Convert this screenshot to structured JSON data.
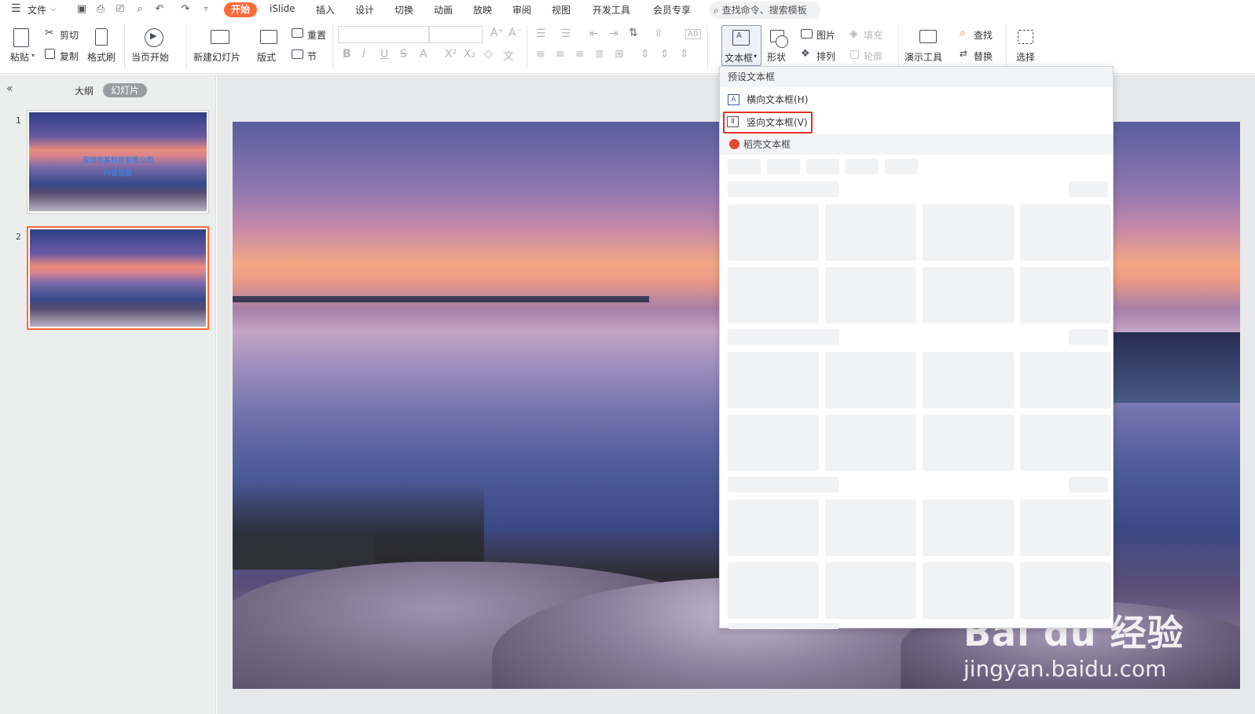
{
  "menubar": {
    "file_label": "文件",
    "tabs": [
      "开始",
      "iSlide",
      "插入",
      "设计",
      "切换",
      "动画",
      "放映",
      "审阅",
      "视图",
      "开发工具",
      "会员专享"
    ],
    "search_placeholder": "查找命令、搜索模板"
  },
  "ribbon": {
    "paste": "粘贴",
    "cut": "剪切",
    "copy": "复制",
    "format_painter": "格式刷",
    "from_current": "当页开始",
    "new_slide": "新建幻灯片",
    "layout": "版式",
    "reset": "重置",
    "section": "节",
    "textbox": "文本框",
    "shapes": "形状",
    "picture": "图片",
    "arrange": "排列",
    "fill": "填充",
    "outline": "轮廓",
    "present_tools": "演示工具",
    "find": "查找",
    "replace": "替换",
    "select": "选择"
  },
  "leftpane": {
    "outline_tab": "大纲",
    "slides_tab": "幻灯片",
    "slides": [
      {
        "number": "1",
        "line1": "深圳市某科技有限公司",
        "line2": "抖音运营"
      },
      {
        "number": "2"
      }
    ]
  },
  "dropdown": {
    "preset_header": "预设文本框",
    "horizontal": "横向文本框(H)",
    "vertical": "竖向文本框(V)",
    "docer": "稻壳文本框"
  },
  "watermark": {
    "brand": "Bai du 经验",
    "url": "jingyan.baidu.com"
  },
  "colors": {
    "accent": "#ff6a3c",
    "highlight": "#e0312c"
  }
}
